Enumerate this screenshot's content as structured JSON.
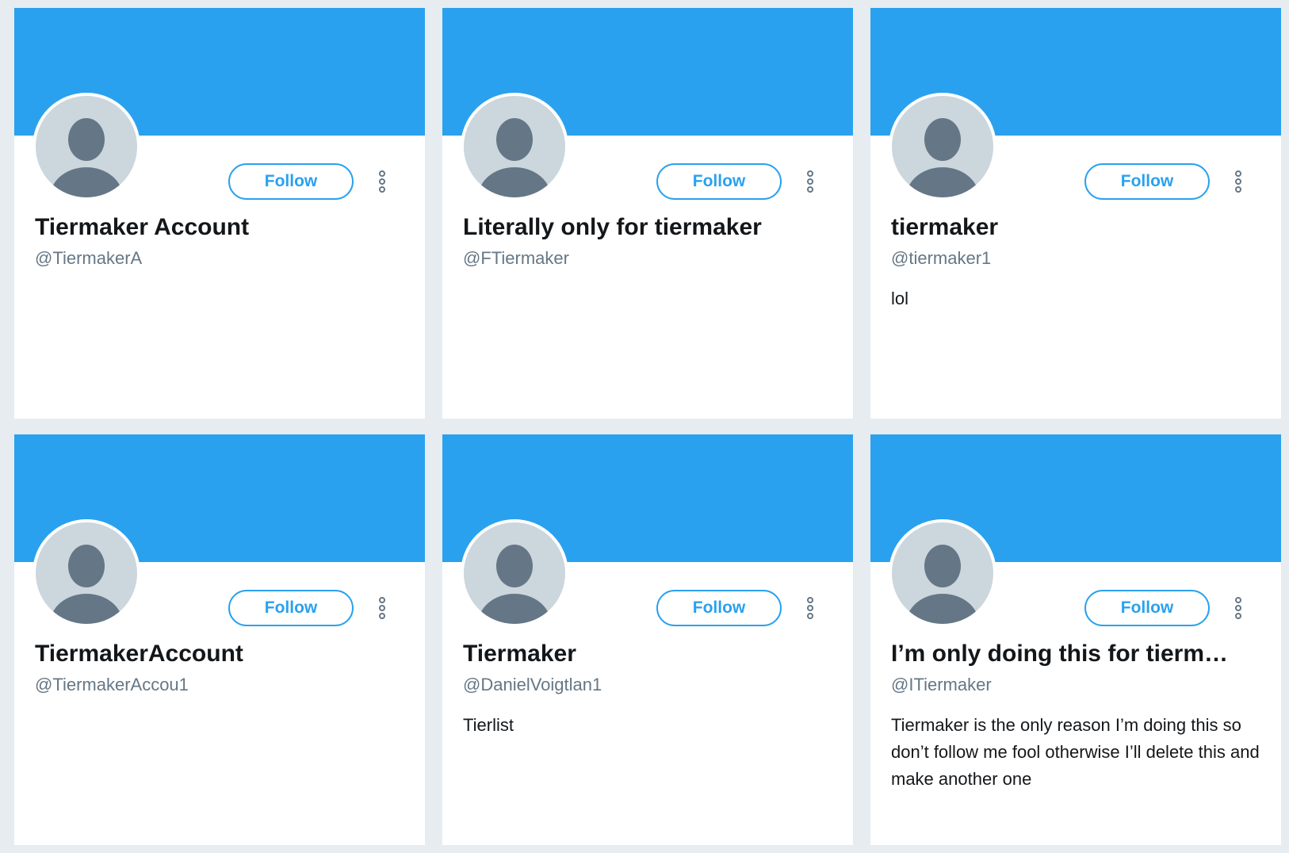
{
  "colors": {
    "page_background": "#e6ecf0",
    "banner": "#2aa1ee",
    "accent": "#2aa1ee",
    "avatar_background": "#ccd6dd",
    "avatar_figure": "#657786",
    "name_text": "#14171a",
    "handle_text": "#657786"
  },
  "icons": {
    "avatar": "default-profile-icon",
    "more": "vertical-ellipsis-icon"
  },
  "cards": [
    {
      "name": "Tiermaker Account",
      "handle": "@TiermakerA",
      "bio": "",
      "follow_label": "Follow"
    },
    {
      "name": "Literally only for tiermaker",
      "handle": "@FTiermaker",
      "bio": "",
      "follow_label": "Follow"
    },
    {
      "name": "tiermaker",
      "handle": "@tiermaker1",
      "bio": "lol",
      "follow_label": "Follow"
    },
    {
      "name": "TiermakerAccount",
      "handle": "@TiermakerAccou1",
      "bio": "",
      "follow_label": "Follow"
    },
    {
      "name": "Tiermaker",
      "handle": "@DanielVoigtlan1",
      "bio": "Tierlist",
      "follow_label": "Follow"
    },
    {
      "name": "I’m only doing this for tierm…",
      "handle": "@ITiermaker",
      "bio": "Tiermaker is the only reason I’m doing this so don’t follow me fool otherwise I’ll delete this and make another one",
      "follow_label": "Follow"
    }
  ]
}
